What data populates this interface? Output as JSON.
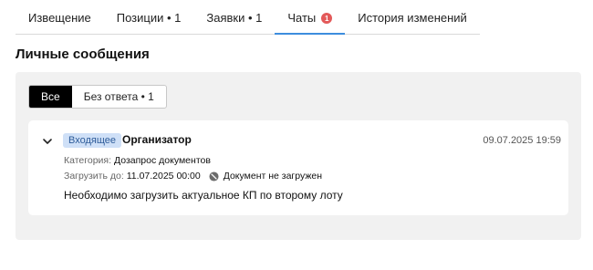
{
  "tabs": [
    {
      "label": "Извещение",
      "active": false
    },
    {
      "label": "Позиции • 1",
      "active": false
    },
    {
      "label": "Заявки • 1",
      "active": false
    },
    {
      "label": "Чаты",
      "active": true,
      "badge": "1"
    },
    {
      "label": "История изменений",
      "active": false
    }
  ],
  "section_title": "Личные сообщения",
  "filters": {
    "all": "Все",
    "unanswered": "Без ответа • 1",
    "selected": "all"
  },
  "message": {
    "tag": "Входящее",
    "sender": "Организатор",
    "date": "09.07.2025 19:59",
    "category_label": "Категория:",
    "category_value": "Дозапрос документов",
    "upload_label": "Загрузить до:",
    "upload_value": "11.07.2025 00:00",
    "doc_status": "Документ не загружен",
    "text": "Необходимо загрузить актуальное КП по второму лоту"
  },
  "colors": {
    "accent": "#3d8dde",
    "badge": "#e35959",
    "tag_bg": "#cfe0f7",
    "panel_bg": "#f1f1f1"
  }
}
